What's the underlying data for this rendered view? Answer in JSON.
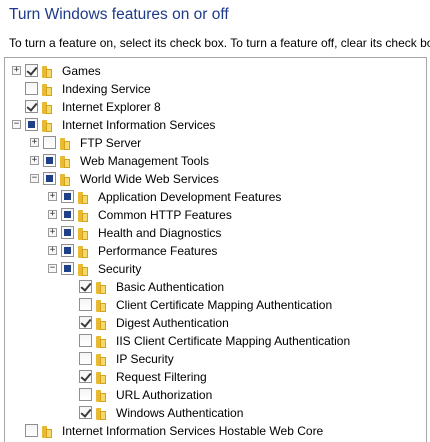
{
  "title": "Turn Windows features on or off",
  "description": "To turn a feature on, select its check box. To turn a feature off, clear its check box.",
  "features": [
    {
      "label": "Games",
      "level": 0,
      "expander": "+",
      "state": "checked"
    },
    {
      "label": "Indexing Service",
      "level": 0,
      "expander": "",
      "state": "unchecked"
    },
    {
      "label": "Internet Explorer 8",
      "level": 0,
      "expander": "",
      "state": "checked"
    },
    {
      "label": "Internet Information Services",
      "level": 0,
      "expander": "-",
      "state": "partial"
    },
    {
      "label": "FTP Server",
      "level": 1,
      "expander": "+",
      "state": "unchecked"
    },
    {
      "label": "Web Management Tools",
      "level": 1,
      "expander": "+",
      "state": "partial"
    },
    {
      "label": "World Wide Web Services",
      "level": 1,
      "expander": "-",
      "state": "partial"
    },
    {
      "label": "Application Development Features",
      "level": 2,
      "expander": "+",
      "state": "partial"
    },
    {
      "label": "Common HTTP Features",
      "level": 2,
      "expander": "+",
      "state": "partial"
    },
    {
      "label": "Health and Diagnostics",
      "level": 2,
      "expander": "+",
      "state": "partial"
    },
    {
      "label": "Performance Features",
      "level": 2,
      "expander": "+",
      "state": "partial"
    },
    {
      "label": "Security",
      "level": 2,
      "expander": "-",
      "state": "partial"
    },
    {
      "label": "Basic Authentication",
      "level": 3,
      "expander": "",
      "state": "checked"
    },
    {
      "label": "Client Certificate Mapping Authentication",
      "level": 3,
      "expander": "",
      "state": "unchecked"
    },
    {
      "label": "Digest Authentication",
      "level": 3,
      "expander": "",
      "state": "checked"
    },
    {
      "label": "IIS Client Certificate Mapping Authentication",
      "level": 3,
      "expander": "",
      "state": "unchecked"
    },
    {
      "label": "IP Security",
      "level": 3,
      "expander": "",
      "state": "unchecked"
    },
    {
      "label": "Request Filtering",
      "level": 3,
      "expander": "",
      "state": "checked"
    },
    {
      "label": "URL Authorization",
      "level": 3,
      "expander": "",
      "state": "unchecked"
    },
    {
      "label": "Windows Authentication",
      "level": 3,
      "expander": "",
      "state": "checked"
    },
    {
      "label": "Internet Information Services Hostable Web Core",
      "level": 0,
      "expander": "",
      "state": "unchecked"
    }
  ],
  "colors": {
    "title": "#1e3a8a",
    "partial_fill": "#1f3f88",
    "folder": "#e8b932"
  }
}
